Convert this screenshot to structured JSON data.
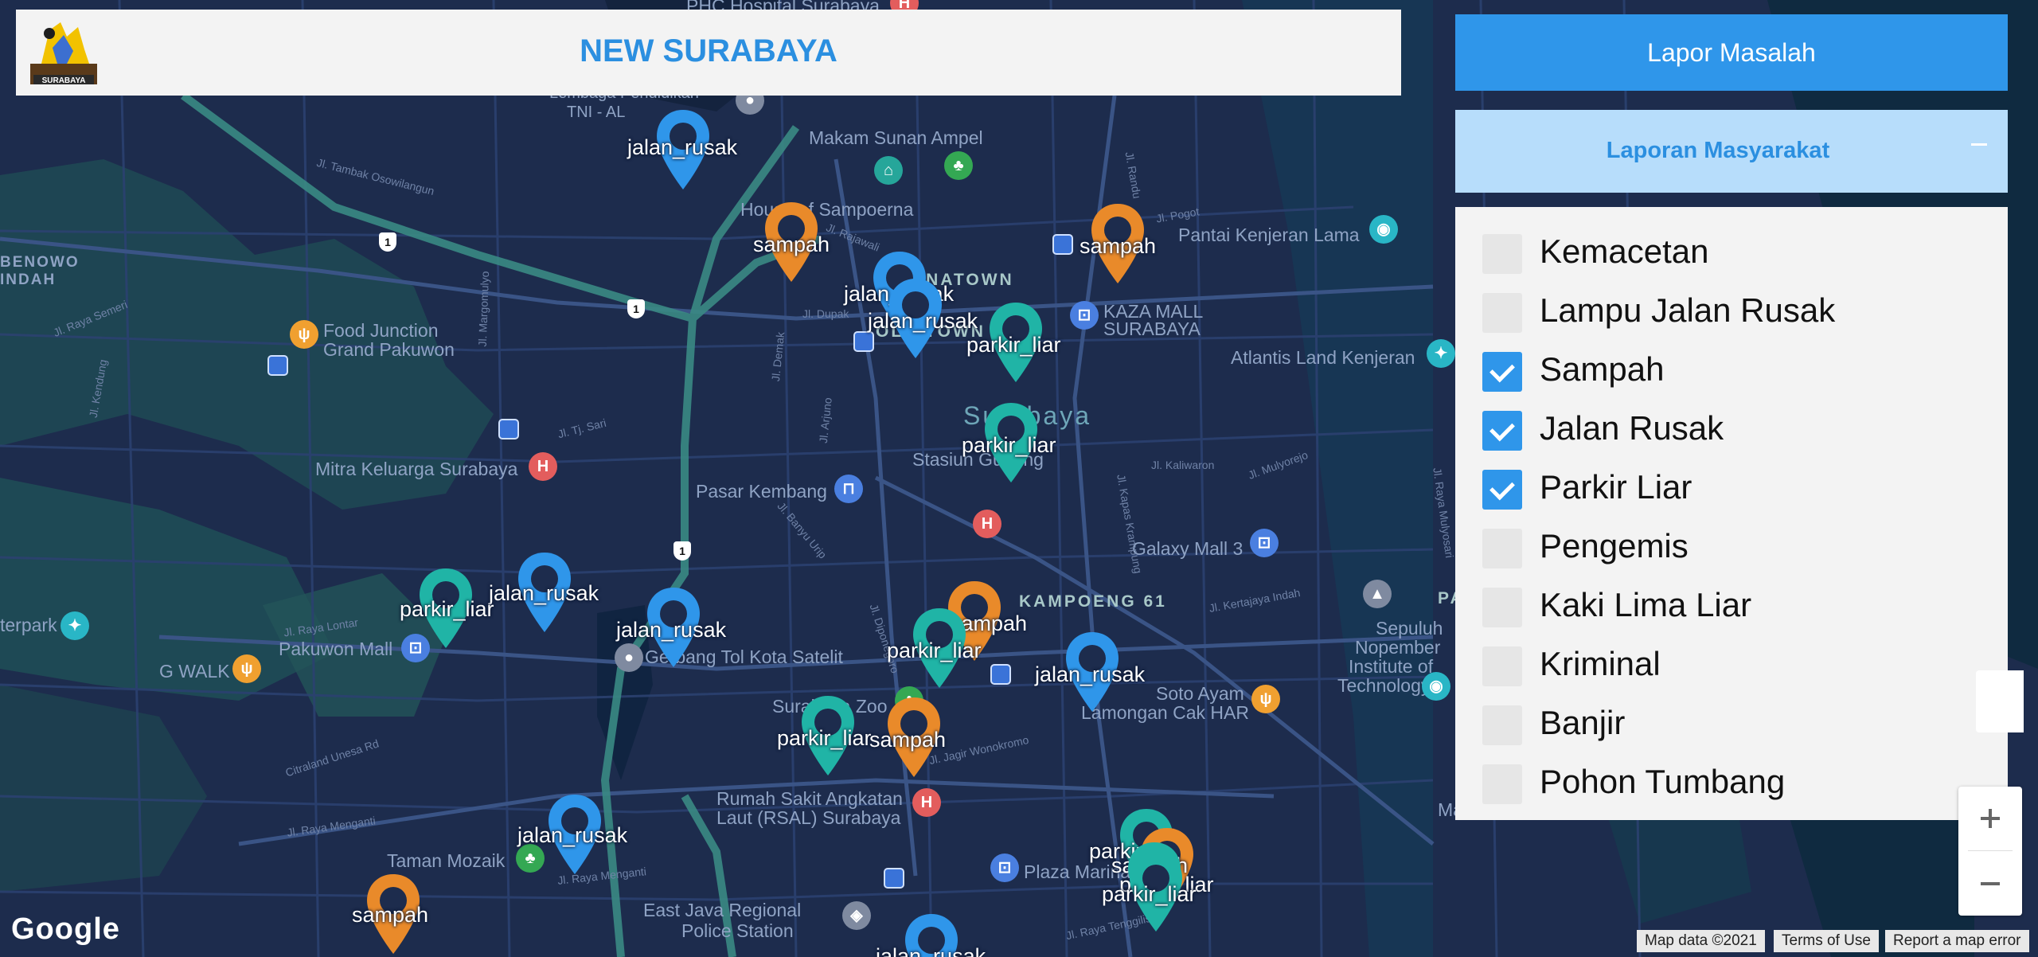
{
  "header": {
    "title": "NEW SURABAYA",
    "logo_text": "SURABAYA"
  },
  "actions": {
    "report_button": "Lapor Masalah",
    "reports_panel_title": "Laporan Masyarakat",
    "collapse_icon": "minus-icon"
  },
  "categories": [
    {
      "label": "Kemacetan",
      "checked": false
    },
    {
      "label": "Lampu Jalan Rusak",
      "checked": false
    },
    {
      "label": "Sampah",
      "checked": true
    },
    {
      "label": "Jalan Rusak",
      "checked": true
    },
    {
      "label": "Parkir Liar",
      "checked": true
    },
    {
      "label": "Pengemis",
      "checked": false
    },
    {
      "label": "Kaki Lima Liar",
      "checked": false
    },
    {
      "label": "Kriminal",
      "checked": false
    },
    {
      "label": "Banjir",
      "checked": false
    },
    {
      "label": "Pohon Tumbang",
      "checked": false
    }
  ],
  "map": {
    "colors": {
      "jalan_rusak": "#2f96ea",
      "sampah": "#e98a2a",
      "parkir_liar": "#20b4a6"
    },
    "places": {
      "phc": "PHC Hospital Surabaya",
      "lembaga": "Lembaga Pendidikan",
      "tnial": "TNI - AL",
      "sunan": "Makam Sunan Ampel",
      "sampoerna": "House of Sampoerna",
      "kenjeran_lama": "Pantai Kenjeran Lama",
      "benowo1": "BENOWO",
      "benowo2": "INDAH",
      "chinatown": "CHINATOWN",
      "oldtown": "OLD TOWN",
      "kaza1": "KAZA MALL",
      "kaza2": "SURABAYA",
      "atlantis": "Atlantis Land Kenjeran",
      "foodjunction1": "Food Junction",
      "foodjunction2": "Grand Pakuwon",
      "city": "Surabaya",
      "stasiun": "Stasiun Gubeng",
      "mitra": "Mitra Keluarga Surabaya",
      "pasar": "Pasar Kembang",
      "galaxy": "Galaxy Mall 3",
      "kampoeng": "KAMPOENG 61",
      "pakuwon_label": "PAKUW",
      "its1": "Sepuluh",
      "its2": "Nopember",
      "its3": "Institute of",
      "its4": "Technology...",
      "pakuwon": "Pakuwon Mall",
      "gwalk": "G WALK",
      "waterpark": "terpark",
      "gerbang": "Gerbang Tol Kota Satelit",
      "zoo": "Surabaya Zoo",
      "sotoayam": "Soto Ayam",
      "lamongan": "Lamongan Cak HAR",
      "rsal1": "Rumah Sakit Angkatan",
      "rsal2": "Laut (RSAL) Surabaya",
      "mangrove": "Mangrove",
      "mozaik": "Taman Mozaik",
      "plaza": "Plaza Marina",
      "police1": "East Java Regional",
      "police2": "Police Station"
    },
    "streets": {
      "s1": "Jl. Tambak Osowilangun",
      "s2": "Jl. Raya Semeri",
      "s3": "Jl. Margomulyo",
      "s4": "Jl. Kendung",
      "s5": "Jl. Tj. Sari",
      "s6": "Jl. Rajawali",
      "s7": "Jl. Dupak",
      "s8": "Jl. Demak",
      "s9": "Jl. Arjuno",
      "s10": "Jl. Banyu Urip",
      "s11": "Jl. Kaliwaron",
      "s12": "Jl. Mulyorejo",
      "s13": "Jl. Pogot",
      "s14": "Jl. Randu",
      "s15": "Jl. Kapas Krampung",
      "s16": "Jl. Raya Mulyosari",
      "s17": "Jl. Raya Lontar",
      "s18": "Jl. Diponegoro",
      "s19": "Jl. Kertajaya Indah",
      "s20": "Jl. Jagir Wonokromo",
      "s21": "Citraland Unesa Rd",
      "s22": "Jl. Raya Menganti",
      "s23": "Jl. Raya Menganti",
      "s24": "Jl. Raya Tenggilis"
    },
    "markers": [
      {
        "type": "jalan_rusak",
        "label": "jalan_rusak"
      },
      {
        "type": "sampah",
        "label": "sampah"
      },
      {
        "type": "sampah",
        "label": "sampah"
      },
      {
        "type": "jalan_rusak",
        "label": "jalan_rusak"
      },
      {
        "type": "jalan_rusak",
        "label": "jalan_rusak"
      },
      {
        "type": "parkir_liar",
        "label": "parkir_liar"
      },
      {
        "type": "parkir_liar",
        "label": "parkir_liar"
      },
      {
        "type": "jalan_rusak",
        "label": "jalan_rusak"
      },
      {
        "type": "parkir_liar",
        "label": "parkir_liar"
      },
      {
        "type": "jalan_rusak",
        "label": "jalan_rusak"
      },
      {
        "type": "sampah",
        "label": "sampah"
      },
      {
        "type": "parkir_liar",
        "label": "parkir_liar"
      },
      {
        "type": "jalan_rusak",
        "label": "jalan_rusak"
      },
      {
        "type": "parkir_liar",
        "label": "parkir_liar"
      },
      {
        "type": "sampah",
        "label": "sampah"
      },
      {
        "type": "jalan_rusak",
        "label": "jalan_rusak"
      },
      {
        "type": "sampah",
        "label": "sampah"
      },
      {
        "type": "parkir_liar",
        "label": "parkir_liar"
      },
      {
        "type": "sampah",
        "label": "sampah"
      },
      {
        "type": "parkir_liar",
        "label": "parkir_liar"
      },
      {
        "type": "parkir_liar",
        "label": "parkir_liar"
      },
      {
        "type": "jalan_rusak",
        "label": "jalan_rusak"
      }
    ]
  },
  "footer": {
    "google": "Google",
    "map_data": "Map data ©2021",
    "terms": "Terms of Use",
    "report_error": "Report a map error"
  }
}
